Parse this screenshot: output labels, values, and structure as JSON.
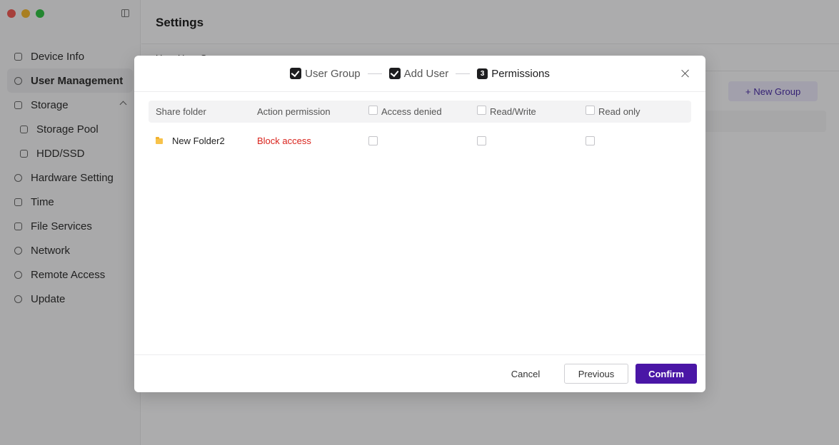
{
  "window": {
    "controls": [
      "close",
      "minimize",
      "zoom"
    ]
  },
  "sidebar": {
    "items": [
      {
        "label": "Device Info",
        "icon": "device-icon"
      },
      {
        "label": "User Management",
        "icon": "user-icon",
        "active": true
      },
      {
        "label": "Storage",
        "icon": "storage-icon",
        "expanded": true
      },
      {
        "label": "Storage Pool",
        "icon": "pool-icon",
        "sub": true
      },
      {
        "label": "HDD/SSD",
        "icon": "disk-icon",
        "sub": true
      },
      {
        "label": "Hardware Setting",
        "icon": "hardware-icon"
      },
      {
        "label": "Time",
        "icon": "clock-icon"
      },
      {
        "label": "File Services",
        "icon": "file-icon"
      },
      {
        "label": "Network",
        "icon": "globe-icon"
      },
      {
        "label": "Remote Access",
        "icon": "antenna-icon"
      },
      {
        "label": "Update",
        "icon": "update-icon"
      }
    ]
  },
  "main": {
    "title": "Settings",
    "tab_partial": "User  User Group",
    "new_group_label": "New Group"
  },
  "modal": {
    "steps": [
      {
        "label": "User Group",
        "state": "done"
      },
      {
        "label": "Add User",
        "state": "done"
      },
      {
        "number": "3",
        "label": "Permissions",
        "state": "current"
      }
    ],
    "table": {
      "headers": [
        "Share folder",
        "Action permission",
        "Access denied",
        "Read/Write",
        "Read only"
      ],
      "rows": [
        {
          "folder": "New Folder2",
          "permission": "Block access",
          "access_denied": false,
          "read_write": false,
          "read_only": false
        }
      ]
    },
    "buttons": {
      "cancel": "Cancel",
      "previous": "Previous",
      "confirm": "Confirm"
    }
  },
  "colors": {
    "accent": "#4a16a6",
    "danger": "#d9231c",
    "folder": "#f7c24a"
  }
}
